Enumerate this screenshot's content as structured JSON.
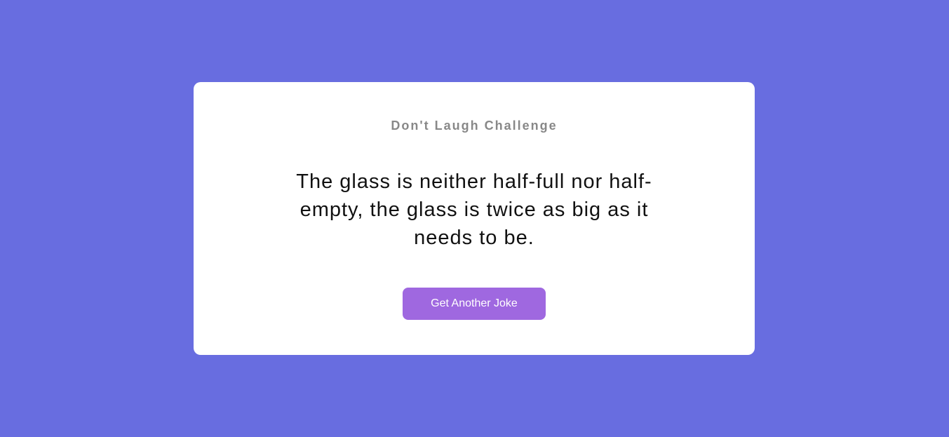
{
  "card": {
    "title": "Don't Laugh Challenge",
    "joke": "The glass is neither half-full nor half-empty, the glass is twice as big as it needs to be.",
    "button_label": "Get Another Joke"
  },
  "colors": {
    "background": "#686de0",
    "card": "#ffffff",
    "title": "#888888",
    "joke_text": "#111111",
    "button": "#9f68e0",
    "button_text": "#ffffff"
  }
}
